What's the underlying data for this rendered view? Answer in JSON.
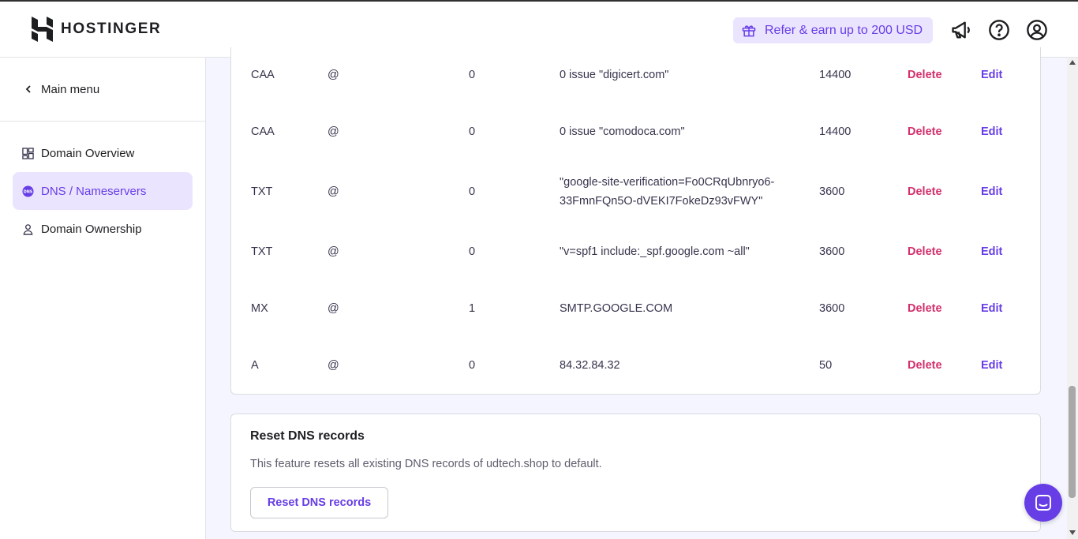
{
  "brand": {
    "name": "HOSTINGER",
    "accent": "#673de6",
    "danger": "#d42e6b"
  },
  "header": {
    "refer_label": "Refer & earn up to 200 USD",
    "icons": [
      "gift-icon",
      "megaphone-icon",
      "help-icon",
      "account-icon"
    ]
  },
  "sidebar": {
    "back_label": "Main menu",
    "items": [
      {
        "label": "Domain Overview",
        "icon": "grid-icon",
        "active": false
      },
      {
        "label": "DNS / Nameservers",
        "icon": "dns-icon",
        "active": true
      },
      {
        "label": "Domain Ownership",
        "icon": "person-icon",
        "active": false
      }
    ]
  },
  "records": [
    {
      "type": "CAA",
      "name": "@",
      "priority": "0",
      "content": "0 issue \"digicert.com\"",
      "ttl": "14400",
      "delete": "Delete",
      "edit": "Edit"
    },
    {
      "type": "CAA",
      "name": "@",
      "priority": "0",
      "content": "0 issue \"comodoca.com\"",
      "ttl": "14400",
      "delete": "Delete",
      "edit": "Edit"
    },
    {
      "type": "TXT",
      "name": "@",
      "priority": "0",
      "content": "\"google-site-verification=Fo0CRqUbnryo6-",
      "content2": "33FmnFQn5O-dVEKI7FokeDz93vFWY\"",
      "ttl": "3600",
      "delete": "Delete",
      "edit": "Edit"
    },
    {
      "type": "TXT",
      "name": "@",
      "priority": "0",
      "content": "\"v=spf1 include:_spf.google.com ~all\"",
      "ttl": "3600",
      "delete": "Delete",
      "edit": "Edit"
    },
    {
      "type": "MX",
      "name": "@",
      "priority": "1",
      "content": "SMTP.GOOGLE.COM",
      "ttl": "3600",
      "delete": "Delete",
      "edit": "Edit"
    },
    {
      "type": "A",
      "name": "@",
      "priority": "0",
      "content": "84.32.84.32",
      "ttl": "50",
      "delete": "Delete",
      "edit": "Edit"
    }
  ],
  "reset": {
    "title": "Reset DNS records",
    "description": "This feature resets all existing DNS records of udtech.shop to default.",
    "button_label": "Reset DNS records"
  }
}
